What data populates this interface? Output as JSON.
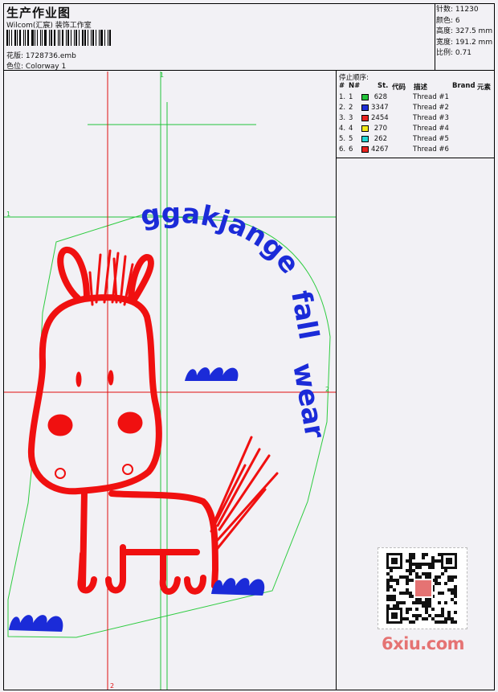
{
  "header": {
    "title": "生产作业图",
    "subtitle": "Wilcom(汇宸) 装饰工作室",
    "design_label": "花版:",
    "design_value": "1728736.emb",
    "colorway_label": "色位:",
    "colorway_value": "Colorway 1"
  },
  "stats": {
    "stitches_label": "针数:",
    "stitches_value": "11230",
    "colors_label": "颜色:",
    "colors_value": "6",
    "height_label": "高度:",
    "height_value": "327.5 mm",
    "width_label": "宽度:",
    "width_value": "191.2 mm",
    "scale_label": "比例:",
    "scale_value": "0.71"
  },
  "thread_panel": {
    "title": "停止顺序:",
    "headers": {
      "num": "#",
      "needle": "N#",
      "st": "St.",
      "code": "代码",
      "desc": "描述",
      "brand": "Brand",
      "element": "元素"
    },
    "rows": [
      {
        "num": "1.",
        "needle": "1",
        "st": "628",
        "color": "#22c33a",
        "desc": "Thread #1"
      },
      {
        "num": "2.",
        "needle": "2",
        "st": "3347",
        "color": "#1f2fd6",
        "desc": "Thread #2"
      },
      {
        "num": "3.",
        "needle": "3",
        "st": "2454",
        "color": "#e8231f",
        "desc": "Thread #3"
      },
      {
        "num": "4.",
        "needle": "4",
        "st": "270",
        "color": "#f2ea1a",
        "desc": "Thread #4"
      },
      {
        "num": "5.",
        "needle": "5",
        "st": "262",
        "color": "#22d6d3",
        "desc": "Thread #5"
      },
      {
        "num": "6.",
        "needle": "6",
        "st": "4267",
        "color": "#e8231f",
        "desc": "Thread #6"
      }
    ]
  },
  "design": {
    "text_line1": "ggakjange",
    "text_line2": "fall",
    "text_line3": "wear",
    "guide_labels": {
      "top": "1",
      "left": "1",
      "right": "2",
      "bottom": "2"
    },
    "colors": {
      "outline": "#2ecc40",
      "body": "#f01010",
      "text": "#1b2bd8",
      "guide": "#22c33a",
      "center": "#e01010"
    }
  },
  "watermark": "6xiu.com"
}
